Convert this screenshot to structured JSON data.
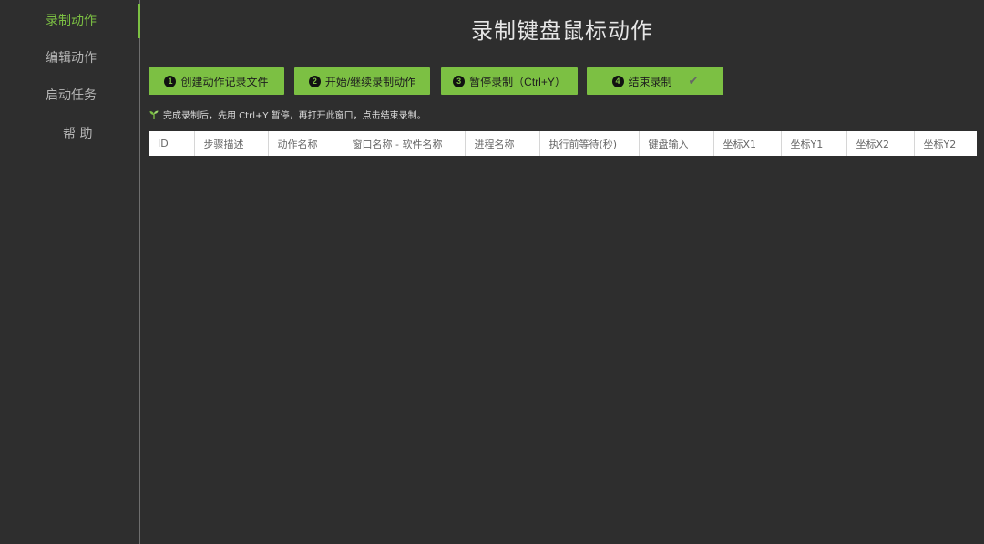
{
  "sidebar": {
    "items": [
      {
        "label": "录制动作",
        "active": true
      },
      {
        "label": "编辑动作",
        "active": false
      },
      {
        "label": "启动任务",
        "active": false
      },
      {
        "label": "帮 助",
        "active": false
      }
    ]
  },
  "main": {
    "title": "录制键盘鼠标动作",
    "buttons": [
      {
        "num": "1",
        "label": "创建动作记录文件"
      },
      {
        "num": "2",
        "label": "开始/继续录制动作"
      },
      {
        "num": "3",
        "label": "暂停录制（Ctrl+Y）"
      },
      {
        "num": "4",
        "label": "结束录制",
        "suffix_icon": "check-icon"
      }
    ],
    "hint": "完成录制后，先用 Ctrl+Y 暂停，再打开此窗口，点击结束录制。",
    "table": {
      "columns": [
        "ID",
        "步骤描述",
        "动作名称",
        "窗口名称 - 软件名称",
        "进程名称",
        "执行前等待(秒)",
        "键盘输入",
        "坐标X1",
        "坐标Y1",
        "坐标X2",
        "坐标Y2"
      ],
      "rows": []
    }
  },
  "colors": {
    "accent": "#7cc043",
    "background": "#2e2e2e",
    "sidebar_text": "#b5b5b5"
  }
}
